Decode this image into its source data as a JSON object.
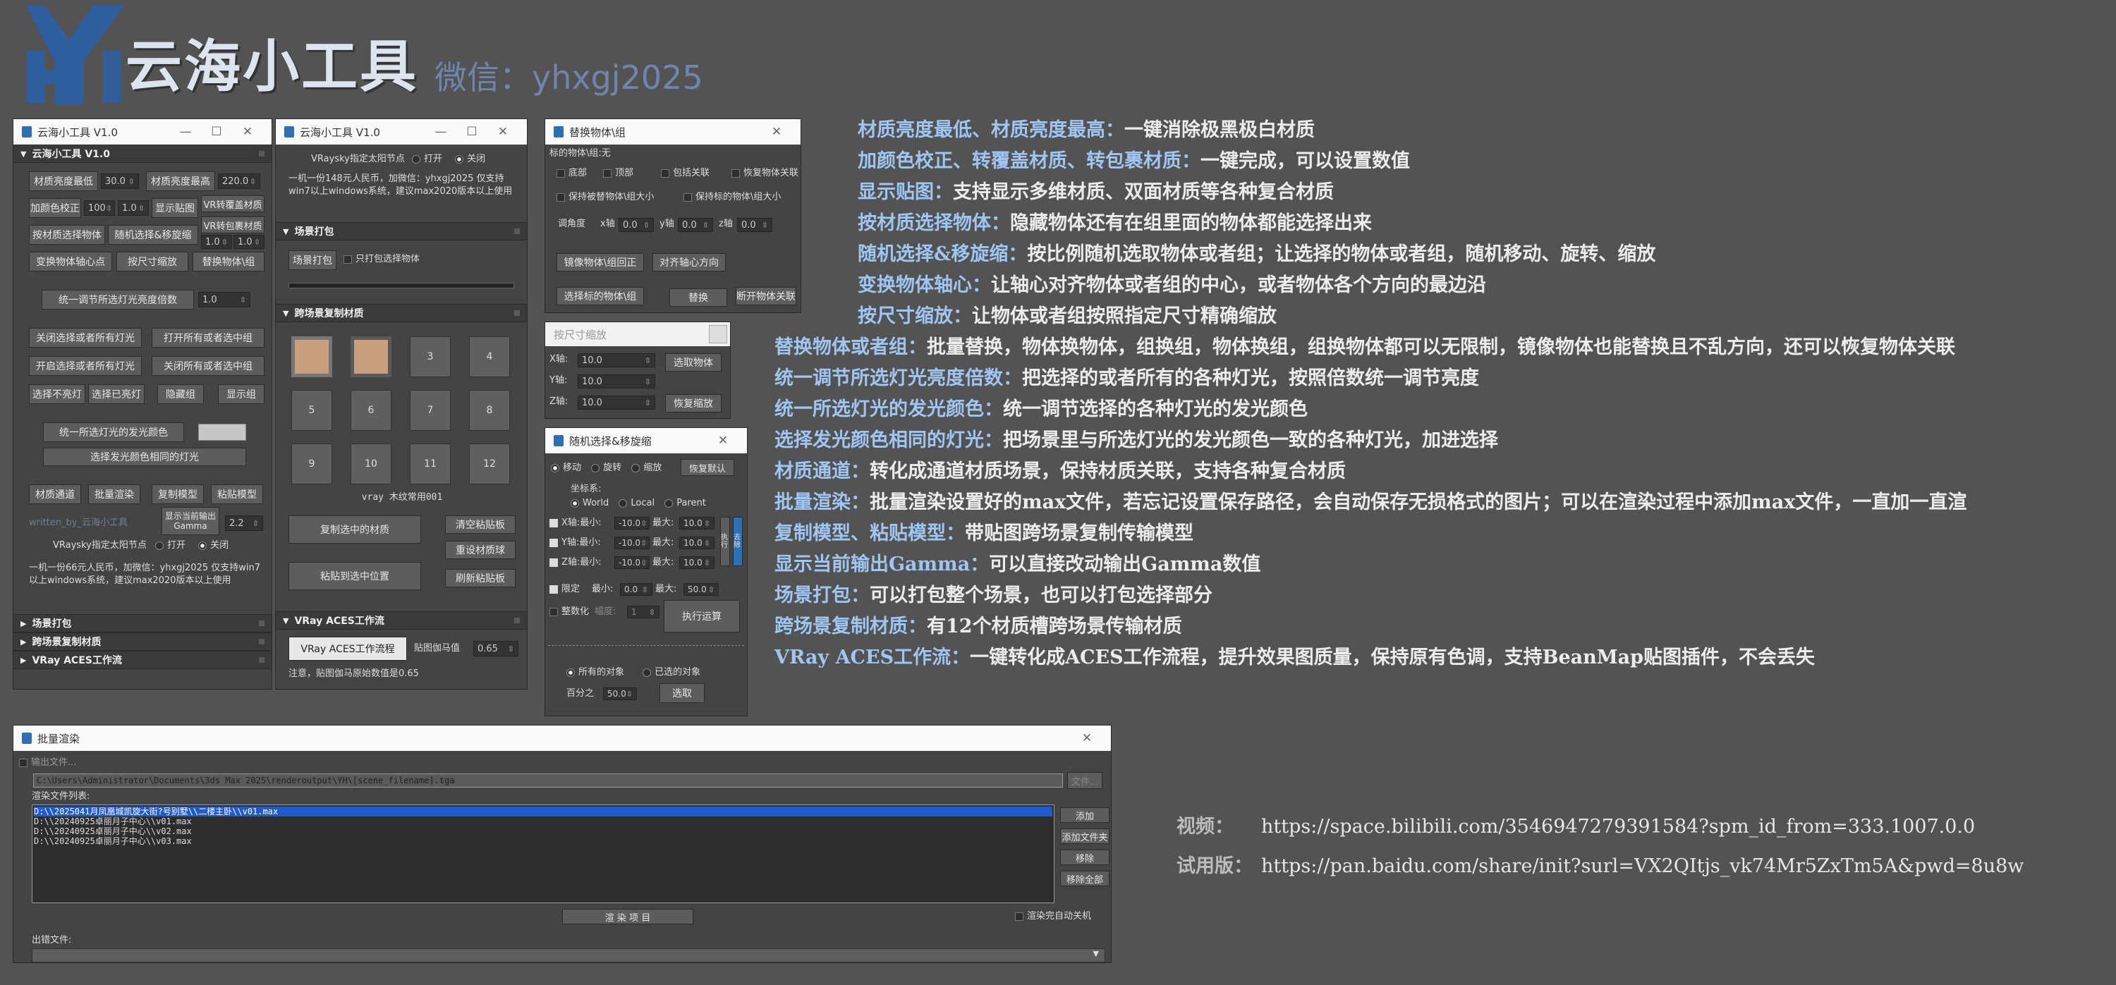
{
  "brand": {
    "name": "云海小工具",
    "wechat": "微信：yhxgj2025",
    "logo_letters": "YH"
  },
  "main_window": {
    "title": "云海小工具 V1.0",
    "rollout_title": "云海小工具 V1.0",
    "mat_min_btn": "材质亮度最低",
    "mat_min_val": "30.0",
    "mat_max_btn": "材质亮度最高",
    "mat_max_val": "220.0",
    "color_fix_btn": "加颜色校正",
    "color_fix_v1": "100",
    "color_fix_v2": "1.0",
    "show_map_btn": "显示贴图",
    "vr_override_btn": "VR转覆盖材质",
    "vr_wrap_btn": "VR转包裹材质",
    "vr_wrap_v1": "1.0",
    "vr_wrap_v2": "1.0",
    "select_by_mat_btn": "按材质选择物体",
    "random_btn": "随机选择&移旋缩",
    "pivot_btn": "变换物体轴心点",
    "scale_btn": "按尺寸缩放",
    "replace_btn": "替换物体\\组",
    "light_mult_btn": "统一调节所选灯光亮度倍数",
    "light_mult_val": "1.0",
    "close_sel_lights_btn": "关闭选择或者所有灯光",
    "open_sel_lights_btn": "打开所有或者选中组",
    "open_sel_lights2_btn": "开启选择或者所有灯光",
    "close_groups_btn": "关闭所有或者选中组",
    "select_off_lights_btn": "选择不亮灯",
    "select_on_lights_btn": "选择已亮灯",
    "hide_group_btn": "隐藏组",
    "show_group_btn": "显示组",
    "unify_color_btn": "统一所选灯光的发光颜色",
    "select_same_color_btn": "选择发光颜色相同的灯光",
    "mat_channel_btn": "材质通道",
    "batch_render_btn": "批量渲染",
    "copy_model_btn": "复制模型",
    "paste_model_btn": "粘贴模型",
    "gamma_btn": "显示当前输出Gamma",
    "gamma_val": "2.2",
    "faded_text": "written_by_云海小工具",
    "sun_node_label": "VRaysky指定太阳节点",
    "sun_on": "打开",
    "sun_off": "关闭",
    "license_text": "一机一份66元人民币，加微信：yhxgj2025 仅支持win7以上windows系统，建议max2020版本以上使用",
    "rollouts": [
      "场景打包",
      "跨场景复制材质",
      "VRay ACES工作流"
    ]
  },
  "second_window": {
    "title": "云海小工具 V1.0",
    "sun_node_label": "VRaysky指定太阳节点",
    "sun_on": "打开",
    "sun_off": "关闭",
    "license_text": "一机一份148元人民币，加微信：yhxgj2025 仅支持win7以上windows系统，建议max2020版本以上使用",
    "pack_rollout": "场景打包",
    "pack_btn": "场景打包",
    "pack_sel_only": "只打包选择物体",
    "copy_rollout": "跨场景复制材质",
    "slots": [
      "",
      "",
      "3",
      "4",
      "5",
      "6",
      "7",
      "8",
      "9",
      "10",
      "11",
      "12"
    ],
    "slot_caption": "vray 木纹常用001",
    "copy_sel_mat_btn": "复制选中的材质",
    "clear_clip_btn": "清空粘贴板",
    "reset_ball_btn": "重设材质球",
    "paste_to_sel_btn": "粘贴到选中位置",
    "refresh_clip_btn": "刷新粘贴板",
    "aces_rollout": "VRay ACES工作流",
    "aces_btn": "VRay ACES工作流程",
    "gamma_label": "贴图伽马值",
    "gamma_val": "0.65",
    "note": "注意，贴图伽马原始数值是0.65"
  },
  "replace_window": {
    "title": "替换物体\\组",
    "target_label": "标的物体\\组:无",
    "bottom_cb": "底部",
    "top_cb": "顶部",
    "include_link": "包括关联",
    "restore_link": "恢复物体关联",
    "keep_size_cb": "保持被替物体\\组大小",
    "keep_target_size_cb": "保持标的物体\\组大小",
    "angle_label": "调角度",
    "x_label": "x轴",
    "x_val": "0.0",
    "y_label": "y轴",
    "y_val": "0.0",
    "z_label": "z轴",
    "z_val": "0.0",
    "mirror_btn": "镜像物体\\组回正",
    "align_pivot_btn": "对齐轴心方向",
    "select_target_btn": "选择标的物体\\组",
    "replace_btn": "替换",
    "break_link_btn": "断开物体关联"
  },
  "scale_window": {
    "title": "按尺寸缩放",
    "x_label": "X轴:",
    "x_val": "10.0",
    "y_label": "Y轴:",
    "y_val": "10.0",
    "z_label": "Z轴:",
    "z_val": "10.0",
    "pick_btn": "选取物体",
    "restore_btn": "恢复缩放"
  },
  "random_window": {
    "title": "随机选择&移旋缩",
    "mode_move": "移动",
    "mode_rotate": "旋转",
    "mode_scale": "缩放",
    "restore_default_btn": "恢复默认",
    "coord_label": "坐标系:",
    "coord_world": "World",
    "coord_local": "Local",
    "coord_parent": "Parent",
    "x_axis": "X轴:最小:",
    "y_axis": "Y轴:最小:",
    "z_axis": "Z轴:最小:",
    "min_val": "-10.0",
    "max_label": "最大:",
    "max_val": "10.0",
    "side_btn1": "执行",
    "side_btn2": "去除",
    "limit_cb": "限定",
    "limit_min": "最小:",
    "limit_min_val": "0.0",
    "limit_max": "最大:",
    "limit_max_val": "50.0",
    "integer_cb": "整数化",
    "amplitude_label": "幅度:",
    "amplitude_val": "1",
    "run_btn": "执行运算",
    "all_objects": "所有的对象",
    "selected_objects": "已选的对象",
    "percent_label": "百分之",
    "percent_val": "50.0",
    "pick_btn": "选取"
  },
  "batch_window": {
    "title": "批量渲染",
    "output_file_cb": "输出文件...",
    "output_path": "C:\\Users\\Administrator\\Documents\\3ds Max 2025\\renderoutput\\YH\\[scene_filename].tga",
    "file_btn": "文件...",
    "list_label": "渲染文件列表:",
    "files": [
      "D:\\\\2025041月凤凰城凯旋大街?号别墅\\\\二楼主卧\\\\v01.max",
      "D:\\\\20240925卓丽月子中心\\\\v01.max",
      "D:\\\\20240925卓丽月子中心\\\\v02.max",
      "D:\\\\20240925卓丽月子中心\\\\v03.max"
    ],
    "add_btn": "添加",
    "add_folder_btn": "添加文件夹",
    "remove_btn": "移除",
    "remove_all_btn": "移除全部",
    "render_btn": "渲 染 项 目",
    "auto_shutdown_cb": "渲染完自动关机",
    "error_label": "出错文件:"
  },
  "descriptions": [
    {
      "k": "材质亮度最低、材质亮度最高：",
      "v": "一键消除极黑极白材质"
    },
    {
      "k": "加颜色校正、转覆盖材质、转包裹材质：",
      "v": "一键完成，可以设置数值"
    },
    {
      "k": "显示贴图：",
      "v": "支持显示多维材质、双面材质等各种复合材质"
    },
    {
      "k": "按材质选择物体：",
      "v": "隐藏物体还有在组里面的物体都能选择出来"
    },
    {
      "k": "随机选择&移旋缩：",
      "v": "按比例随机选取物体或者组；让选择的物体或者组，随机移动、旋转、缩放"
    },
    {
      "k": "变换物体轴心：",
      "v": "让轴心对齐物体或者组的中心，或者物体各个方向的最边沿"
    },
    {
      "k": "按尺寸缩放：",
      "v": "让物体或者组按照指定尺寸精确缩放"
    },
    {
      "k": "替换物体或者组：",
      "v": "批量替换，物体换物体，组换组，物体换组，组换物体都可以无限制，镜像物体也能替换且不乱方向，还可以恢复物体关联"
    },
    {
      "k": "统一调节所选灯光亮度倍数：",
      "v": "把选择的或者所有的各种灯光，按照倍数统一调节亮度"
    },
    {
      "k": "统一所选灯光的发光颜色：",
      "v": "统一调节选择的各种灯光的发光颜色"
    },
    {
      "k": "选择发光颜色相同的灯光：",
      "v": "把场景里与所选灯光的发光颜色一致的各种灯光，加进选择"
    },
    {
      "k": "材质通道：",
      "v": "转化成通道材质场景，保持材质关联，支持各种复合材质"
    },
    {
      "k": "批量渲染：",
      "v": "批量渲染设置好的max文件，若忘记设置保存路径，会自动保存无损格式的图片；可以在渲染过程中添加max文件，一直加一直渲"
    },
    {
      "k": "复制模型、粘贴模型：",
      "v": "带贴图跨场景复制传输模型"
    },
    {
      "k": "显示当前输出Gamma：",
      "v": "可以直接改动输出Gamma数值"
    },
    {
      "k": "场景打包：",
      "v": "可以打包整个场景，也可以打包选择部分"
    },
    {
      "k": "跨场景复制材质：",
      "v": "有12个材质槽跨场景传输材质"
    },
    {
      "k": "VRay ACES工作流：",
      "v": "一键转化成ACES工作流程，提升效果图质量，保持原有色调，支持BeanMap贴图插件，不会丢失"
    }
  ],
  "links": [
    {
      "k": "视频：",
      "v": "https://space.bilibili.com/3546947279391584?spm_id_from=333.1007.0.0"
    },
    {
      "k": "试用版：",
      "v": "https://pan.baidu.com/share/init?surl=VX2QItjs_vk74Mr5ZxTm5A&pwd=8u8w"
    }
  ],
  "colors": {
    "background": "#535353",
    "accent": "#9fc6f2",
    "logo_blue": "#2f5e9e",
    "selection": "#1f5bc9"
  }
}
